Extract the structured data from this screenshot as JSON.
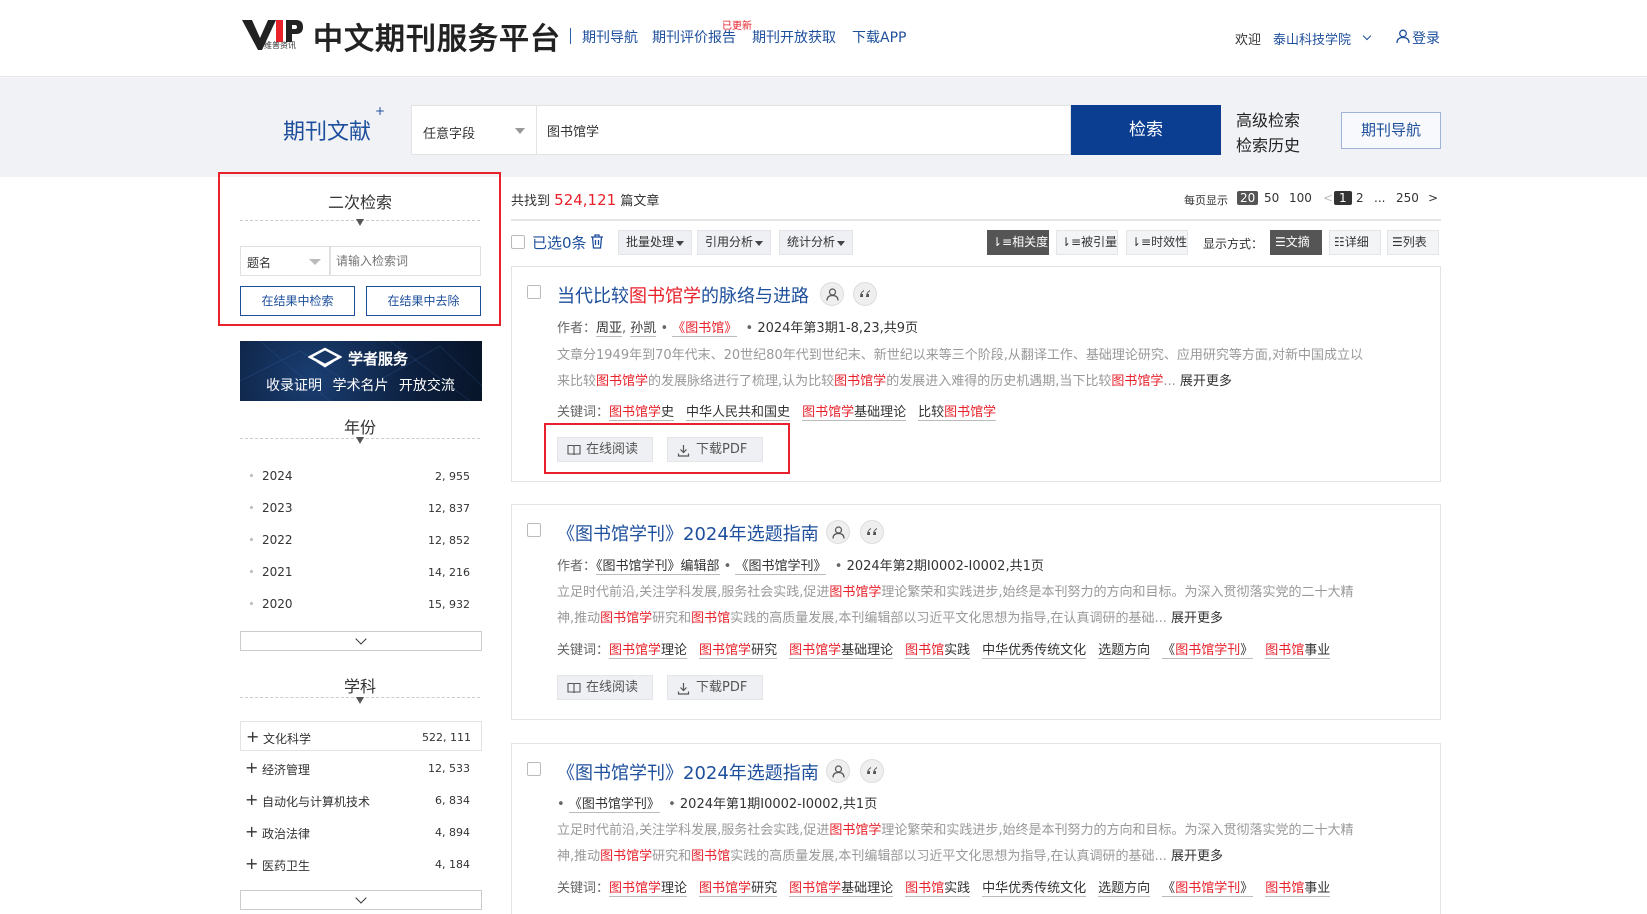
{
  "header": {
    "logo_text": "VIP",
    "logo_sub": "维普资讯",
    "site_title": "中文期刊服务平台",
    "nav": [
      {
        "label": "期刊导航"
      },
      {
        "label": "期刊评价报告",
        "badge": "已更新"
      },
      {
        "label": "期刊开放获取"
      },
      {
        "label": "下载APP"
      }
    ],
    "welcome": "欢迎",
    "institution": "泰山科技学院",
    "login": "登录"
  },
  "search": {
    "label": "期刊文献",
    "plus": "+",
    "field": "任意字段",
    "query": "图书馆学",
    "button": "检索",
    "advanced": "高级检索",
    "history": "检索历史",
    "journal_nav": "期刊导航"
  },
  "sidebar": {
    "secondary_title": "二次检索",
    "field": "题名",
    "placeholder": "请输入检索词",
    "search_in_results": "在结果中检索",
    "remove_from_results": "在结果中去除",
    "banner_title": "学者服务",
    "banner_items": "收录证明 学术名片 开放交流",
    "year_title": "年份",
    "years": [
      {
        "label": "2024",
        "count": "2, 955"
      },
      {
        "label": "2023",
        "count": "12, 837"
      },
      {
        "label": "2022",
        "count": "12, 852"
      },
      {
        "label": "2021",
        "count": "14, 216"
      },
      {
        "label": "2020",
        "count": "15, 932"
      }
    ],
    "subject_title": "学科",
    "subjects": [
      {
        "label": "文化科学",
        "count": "522, 111"
      },
      {
        "label": "经济管理",
        "count": "12, 533"
      },
      {
        "label": "自动化与计算机技术",
        "count": "6, 834"
      },
      {
        "label": "政治法律",
        "count": "4, 894"
      },
      {
        "label": "医药卫生",
        "count": "4, 184"
      }
    ]
  },
  "results": {
    "found_prefix": "共找到",
    "found_count": "524,121",
    "found_suffix": "篇文章",
    "per_page_label": "每页显示",
    "per_page_options": [
      "20",
      "50",
      "100"
    ],
    "pages": {
      "prev": "<",
      "p1": "1",
      "p2": "2",
      "ellipsis": "...",
      "last": "250",
      "next": ">"
    },
    "selected": "已选0条",
    "tools": [
      "批量处理",
      "引用分析",
      "统计分析"
    ],
    "sort": [
      "相关度",
      "被引量",
      "时效性"
    ],
    "display_label": "显示方式：",
    "display": [
      "文摘",
      "详细",
      "列表"
    ],
    "read_online": "在线阅读",
    "download_pdf": "下载PDF",
    "author_label": "作者：",
    "keyword_label": "关键词：",
    "expand_more": "展开更多",
    "items": [
      {
        "title_pre": "当代比较",
        "title_hl": "图书馆学",
        "title_post": "的脉络与进路",
        "authors": [
          "周亚",
          "孙凯"
        ],
        "journal": "《图书馆》",
        "issue": "2024年第3期1-8,23,共9页",
        "abstract_1": "文章分1949年到70年代末、20世纪80年代到世纪末、新世纪以来等三个阶段,从翻译工作、基础理论研究、应用研究等方面,对新中国成立以",
        "abstract_2a": "来比较",
        "abstract_2b": "图书馆学",
        "abstract_2c": "的发展脉络进行了梳理,认为比较",
        "abstract_2d": "图书馆学",
        "abstract_2e": "的发展进入难得的历史机遇期,当下比较",
        "abstract_2f": "图书馆学",
        "abstract_2g": "...",
        "keywords": [
          {
            "hl": "图书馆学",
            "rest": "史"
          },
          {
            "hl": "",
            "rest": "中华人民共和国史"
          },
          {
            "hl": "图书馆学",
            "rest": "基础理论"
          },
          {
            "pre": "比较",
            "hl": "图书馆学",
            "rest": ""
          }
        ]
      },
      {
        "title": "《图书馆学刊》2024年选题指南",
        "authors": [
          "《图书馆学刊》编辑部"
        ],
        "journal": "《图书馆学刊》",
        "issue": "2024年第2期I0002-I0002,共1页",
        "abstract_1a": "立足时代前沿,关注学科发展,服务社会实践,促进",
        "abstract_1b": "图书馆学",
        "abstract_1c": "理论繁荣和实践进步,始终是本刊努力的方向和目标。为深入贯彻落实党的二十大精",
        "abstract_2a": "神,推动",
        "abstract_2b": "图书馆学",
        "abstract_2c": "研究和",
        "abstract_2d": "图书馆",
        "abstract_2e": "实践的高质量发展,本刊编辑部以习近平文化思想为指导,在认真调研的基础...",
        "keywords": [
          {
            "hl": "图书馆学",
            "rest": "理论"
          },
          {
            "hl": "图书馆学",
            "rest": "研究"
          },
          {
            "hl": "图书馆学",
            "rest": "基础理论"
          },
          {
            "hl": "图书馆",
            "rest": "实践"
          },
          {
            "hl": "",
            "rest": "中华优秀传统文化"
          },
          {
            "hl": "",
            "rest": "选题方向"
          },
          {
            "pre": "《",
            "hl": "图书馆学刊",
            "rest": "》"
          },
          {
            "hl": "图书馆",
            "rest": "事业"
          }
        ]
      },
      {
        "title": "《图书馆学刊》2024年选题指南",
        "journal": "《图书馆学刊》",
        "issue": "2024年第1期I0002-I0002,共1页"
      }
    ]
  },
  "colors": {
    "brand_blue": "#0b3d91",
    "link_blue": "#1e4f9c",
    "highlight_red": "#e8212b"
  }
}
